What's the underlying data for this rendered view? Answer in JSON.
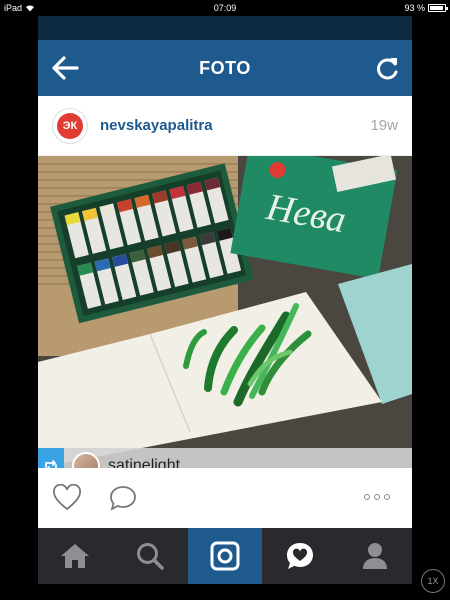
{
  "status_bar": {
    "device": "iPad",
    "time": "07:09",
    "battery": "93 %",
    "battery_level": 0.93
  },
  "nav": {
    "title": "FOTO",
    "back_icon": "arrow-left-icon",
    "refresh_icon": "refresh-icon"
  },
  "post": {
    "username": "nevskayapalitra",
    "time_ago": "19w",
    "avatar_initials": "ЭК",
    "tagged_user": "satinelight",
    "photo_description_icon": "photo"
  },
  "actions": {
    "like_icon": "heart-outline-icon",
    "comment_icon": "comment-bubble-icon",
    "more_icon": "more-dots-icon"
  },
  "tabbar": {
    "items": [
      {
        "name": "home",
        "icon": "home-icon"
      },
      {
        "name": "search",
        "icon": "search-icon"
      },
      {
        "name": "camera",
        "icon": "camera-icon",
        "active": true
      },
      {
        "name": "activity",
        "icon": "heart-bubble-icon"
      },
      {
        "name": "profile",
        "icon": "profile-icon"
      }
    ]
  },
  "zoom": {
    "label": "1X"
  },
  "colors": {
    "brand_blue": "#1f5a8f",
    "repost_blue": "#3aa3e3",
    "tabbar_dark": "#2a2a2e"
  }
}
